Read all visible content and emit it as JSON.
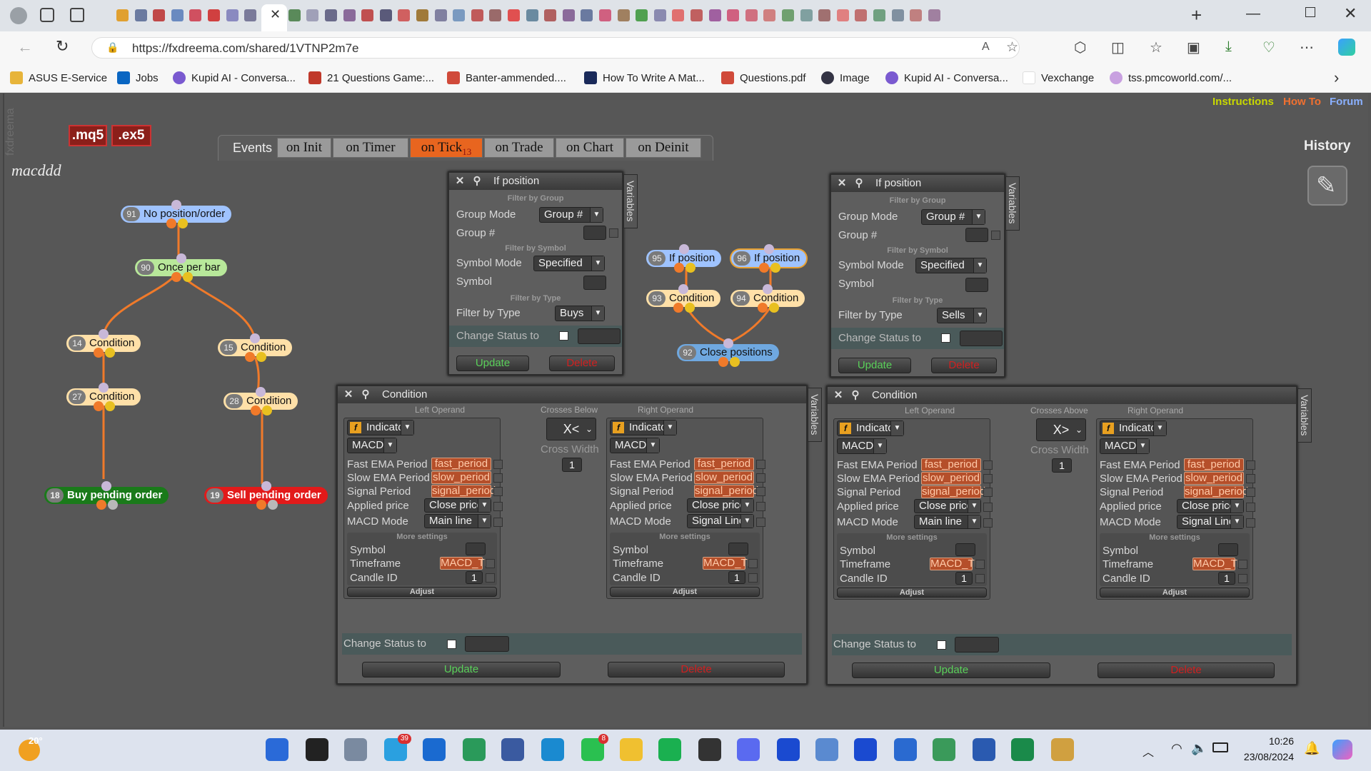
{
  "browser": {
    "url": "https://fxdreema.com/shared/1VTNP2m7e",
    "bookmarks": [
      "ASUS E-Service",
      "Jobs",
      "Kupid AI - Conversa...",
      "21 Questions Game:...",
      "Banter-ammended....",
      "How To Write A Mat...",
      "Questions.pdf",
      "Image",
      "Kupid AI - Conversa...",
      "Vexchange",
      "tss.pmcoworld.com/..."
    ]
  },
  "app": {
    "brand": "fxdreema",
    "mq5": ".mq5",
    "ex5": ".ex5",
    "project": "macddd",
    "links": {
      "instructions": "Instructions",
      "howto": "How To",
      "forum": "Forum"
    },
    "history": "History",
    "events_label": "Events",
    "tabs": [
      "on Init",
      "on Timer",
      "on Tick",
      "on Trade",
      "on Chart",
      "on Deinit"
    ],
    "active_tab": "on Tick",
    "tick_count": "13"
  },
  "nodes": [
    {
      "id": "91",
      "label": "No position/order"
    },
    {
      "id": "90",
      "label": "Once per bar"
    },
    {
      "id": "14",
      "label": "Condition"
    },
    {
      "id": "15",
      "label": "Condition"
    },
    {
      "id": "27",
      "label": "Condition"
    },
    {
      "id": "28",
      "label": "Condition"
    },
    {
      "id": "18",
      "label": "Buy pending order"
    },
    {
      "id": "19",
      "label": "Sell pending order"
    },
    {
      "id": "95",
      "label": "If position"
    },
    {
      "id": "96",
      "label": "If position"
    },
    {
      "id": "93",
      "label": "Condition"
    },
    {
      "id": "94",
      "label": "Condition"
    },
    {
      "id": "92",
      "label": "Close positions"
    }
  ],
  "ifpos": {
    "title": "If position",
    "filter_group": "Filter by Group",
    "group_mode": "Group Mode",
    "group_mode_val": "Group #",
    "group_num": "Group #",
    "filter_symbol": "Filter by Symbol",
    "symbol_mode": "Symbol Mode",
    "symbol_mode_val": "Specified",
    "symbol": "Symbol",
    "filter_type": "Filter by Type",
    "filter_by_type": "Filter by Type",
    "type_left": "Buys",
    "type_right": "Sells",
    "change_status": "Change Status to",
    "update": "Update",
    "delete": "Delete",
    "variables": "Variables"
  },
  "cond": {
    "title": "Condition",
    "left_operand": "Left Operand",
    "right_operand": "Right Operand",
    "op_left_label": "Crosses Below",
    "op_left": "X<",
    "op_right_label": "Crosses Above",
    "op_right": "X>",
    "cross_width": "Cross Width",
    "cross_width_val": "1",
    "indicator": "Indicator",
    "macd": "MACD",
    "fast": "Fast EMA Period",
    "fast_v": "fast_period",
    "slow": "Slow EMA Period",
    "slow_v": "slow_period",
    "signal": "Signal Period",
    "signal_v": "signal_period",
    "applied": "Applied price",
    "applied_v": "Close price",
    "mode": "MACD Mode",
    "mode_main": "Main line",
    "mode_signal": "Signal Line",
    "more": "More settings",
    "symbol": "Symbol",
    "timeframe": "Timeframe",
    "timeframe_v": "MACD_TF",
    "candle": "Candle ID",
    "candle_v": "1",
    "adjust": "Adjust",
    "change_status": "Change Status to",
    "update": "Update",
    "delete": "Delete",
    "variables": "Variables"
  },
  "taskbar": {
    "weather": "20°",
    "time": "10:26",
    "date": "23/08/2024",
    "badge_telegram": "39",
    "badge_whatsapp": "8"
  }
}
